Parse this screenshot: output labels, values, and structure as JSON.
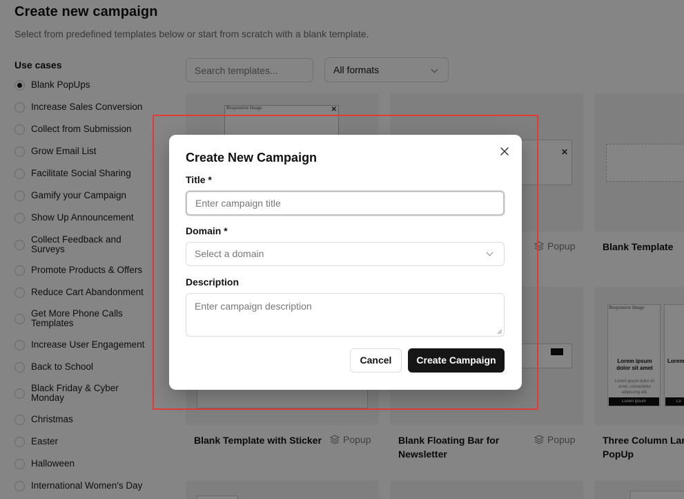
{
  "page": {
    "title": "Create new campaign",
    "subtitle": "Select from predefined templates below or start from scratch with a blank template."
  },
  "sidebar": {
    "heading": "Use cases",
    "items": [
      {
        "label": "Blank PopUps",
        "selected": true
      },
      {
        "label": "Increase Sales Conversion"
      },
      {
        "label": "Collect from Submission"
      },
      {
        "label": "Grow Email List"
      },
      {
        "label": "Facilitate Social Sharing"
      },
      {
        "label": "Gamify your Campaign"
      },
      {
        "label": "Show Up Announcement"
      },
      {
        "label": "Collect Feedback and Surveys"
      },
      {
        "label": "Promote Products & Offers"
      },
      {
        "label": "Reduce Cart Abandonment"
      },
      {
        "label": "Get More Phone Calls Templates"
      },
      {
        "label": "Increase User Engagement"
      },
      {
        "label": "Back to School"
      },
      {
        "label": "Black Friday & Cyber Monday"
      },
      {
        "label": "Christmas"
      },
      {
        "label": "Easter"
      },
      {
        "label": "Halloween"
      },
      {
        "label": "International Women's Day"
      }
    ]
  },
  "filters": {
    "search_placeholder": "Search templates...",
    "format_selected": "All formats"
  },
  "templates": [
    {
      "title": "",
      "tag": "",
      "thumb_text": "Responsive Image"
    },
    {
      "title": "",
      "tag": "Popup"
    },
    {
      "title": "Blank Template",
      "tag": ""
    },
    {
      "title": "Blank Template with Sticker",
      "tag": "Popup"
    },
    {
      "title": "Blank Floating Bar for Newsletter",
      "tag": "Popup"
    },
    {
      "title": "Three Column Larg PopUp",
      "tag": "",
      "thumb_text": "Responsive Image",
      "col_title": "Lorem ipsum dolor sit amet",
      "col_body": "Lorem ipsum dolor sit amet, consectetur adipiscing elit.",
      "col_button": "Lorem ipsum",
      "col_title2": "Lorem",
      "col_button2": "Lo"
    }
  ],
  "modal": {
    "title": "Create New Campaign",
    "title_label": "Title *",
    "title_placeholder": "Enter campaign title",
    "domain_label": "Domain *",
    "domain_placeholder": "Select a domain",
    "description_label": "Description",
    "description_placeholder": "Enter campaign description",
    "cancel_label": "Cancel",
    "create_label": "Create Campaign"
  },
  "colors": {
    "highlight": "#e53935",
    "primary_button": "#161616"
  }
}
